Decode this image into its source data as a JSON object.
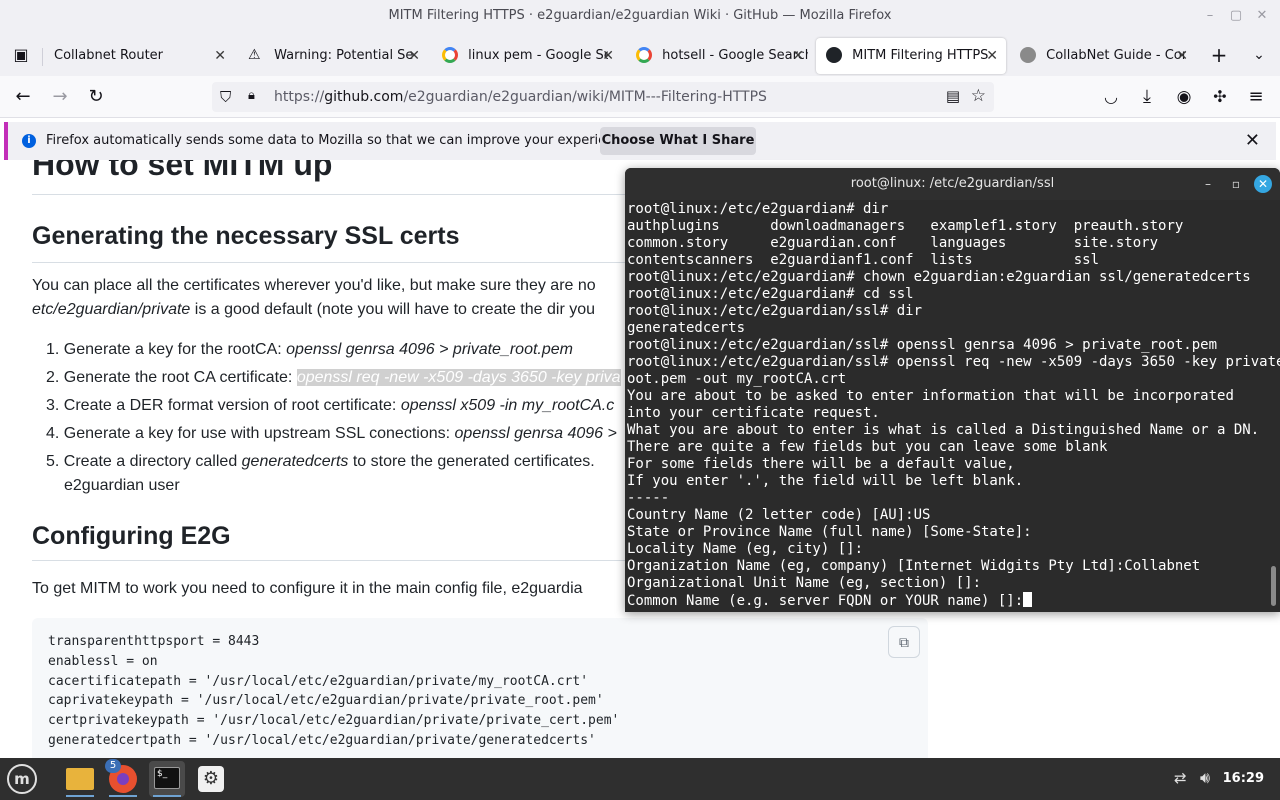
{
  "window": {
    "title": "MITM Filtering HTTPS · e2guardian/e2guardian Wiki · GitHub — Mozilla Firefox"
  },
  "tabs": [
    {
      "title": "Collabnet Router",
      "icon": "folder-icon",
      "active": false
    },
    {
      "title": "Warning: Potential Sec",
      "icon": "warning-icon",
      "active": false
    },
    {
      "title": "linux pem - Google Sea",
      "icon": "google-icon",
      "active": false
    },
    {
      "title": "hotsell - Google Search",
      "icon": "google-icon",
      "active": false
    },
    {
      "title": "MITM Filtering HTTPS",
      "icon": "github-icon",
      "active": true
    },
    {
      "title": "CollabNet Guide - Com",
      "icon": "collabnet-icon",
      "active": false
    }
  ],
  "navbar": {
    "url_prefix": "https://",
    "url_domain": "github.com",
    "url_path": "/e2guardian/e2guardian/wiki/MITM---Filtering-HTTPS"
  },
  "notice": {
    "text": "Firefox automatically sends some data to Mozilla so that we can improve your experience.",
    "button": "Choose What I Share"
  },
  "article": {
    "h1": "How to set MITM up",
    "h2_ssl": "Generating the necessary SSL certs",
    "para_ssl_1": "You can place all the certificates wherever you'd like, but make sure they are no",
    "para_ssl_2_em": "etc/e2guardian/private",
    "para_ssl_2_rest": " is a good default (note you will have to create the dir you",
    "steps": [
      {
        "num": "1.",
        "text": "Generate a key for the rootCA: ",
        "cmd": "openssl genrsa 4096 > private_root.pem"
      },
      {
        "num": "2.",
        "text": "Generate the root CA certificate: ",
        "cmd": "openssl req -new -x509 -days 3650 -key priva"
      },
      {
        "num": "3.",
        "text": "Create a DER format version of root certificate: ",
        "cmd": "openssl x509 -in my_rootCA.c"
      },
      {
        "num": "4.",
        "text": "Generate a key for use with upstream SSL conections: ",
        "cmd": "openssl genrsa 4096 >"
      },
      {
        "num": "5.",
        "text": "Create a directory called ",
        "cmd": "generatedcerts",
        "rest": " to store the generated certificates. ",
        "line2": "e2guardian user"
      }
    ],
    "h2_config": "Configuring E2G",
    "para_config": "To get MITM to work you need to configure it in the main config file, e2guardia",
    "code": "transparenthttpsport = 8443\nenablessl = on\ncacertificatepath = '/usr/local/etc/e2guardian/private/my_rootCA.crt'\ncaprivatekeypath = '/usr/local/etc/e2guardian/private/private_root.pem'\ncertprivatekeypath = '/usr/local/etc/e2guardian/private/private_cert.pem'\ngeneratedcertpath = '/usr/local/etc/e2guardian/private/generatedcerts'"
  },
  "terminal": {
    "title": "root@linux: /etc/e2guardian/ssl",
    "output": "root@linux:/etc/e2guardian# dir\nauthplugins      downloadmanagers   examplef1.story  preauth.story\ncommon.story     e2guardian.conf    languages        site.story\ncontentscanners  e2guardianf1.conf  lists            ssl\nroot@linux:/etc/e2guardian# chown e2guardian:e2guardian ssl/generatedcerts\nroot@linux:/etc/e2guardian# cd ssl\nroot@linux:/etc/e2guardian/ssl# dir\ngeneratedcerts\nroot@linux:/etc/e2guardian/ssl# openssl genrsa 4096 > private_root.pem\nroot@linux:/etc/e2guardian/ssl# openssl req -new -x509 -days 3650 -key private_r\noot.pem -out my_rootCA.crt\nYou are about to be asked to enter information that will be incorporated\ninto your certificate request.\nWhat you are about to enter is what is called a Distinguished Name or a DN.\nThere are quite a few fields but you can leave some blank\nFor some fields there will be a default value,\nIf you enter '.', the field will be left blank.\n-----\nCountry Name (2 letter code) [AU]:US\nState or Province Name (full name) [Some-State]:\nLocality Name (eg, city) []:\nOrganization Name (eg, company) [Internet Widgits Pty Ltd]:Collabnet\nOrganizational Unit Name (eg, section) []:\nCommon Name (e.g. server FQDN or YOUR name) []:"
  },
  "taskbar": {
    "badge": "5",
    "clock": "16:29"
  },
  "colors": {
    "notice_accent": "#c22eb8",
    "terminal_bg": "#2b2b2b",
    "taskbar_bg": "#2f2f2f",
    "close_button": "#35a7e2"
  }
}
